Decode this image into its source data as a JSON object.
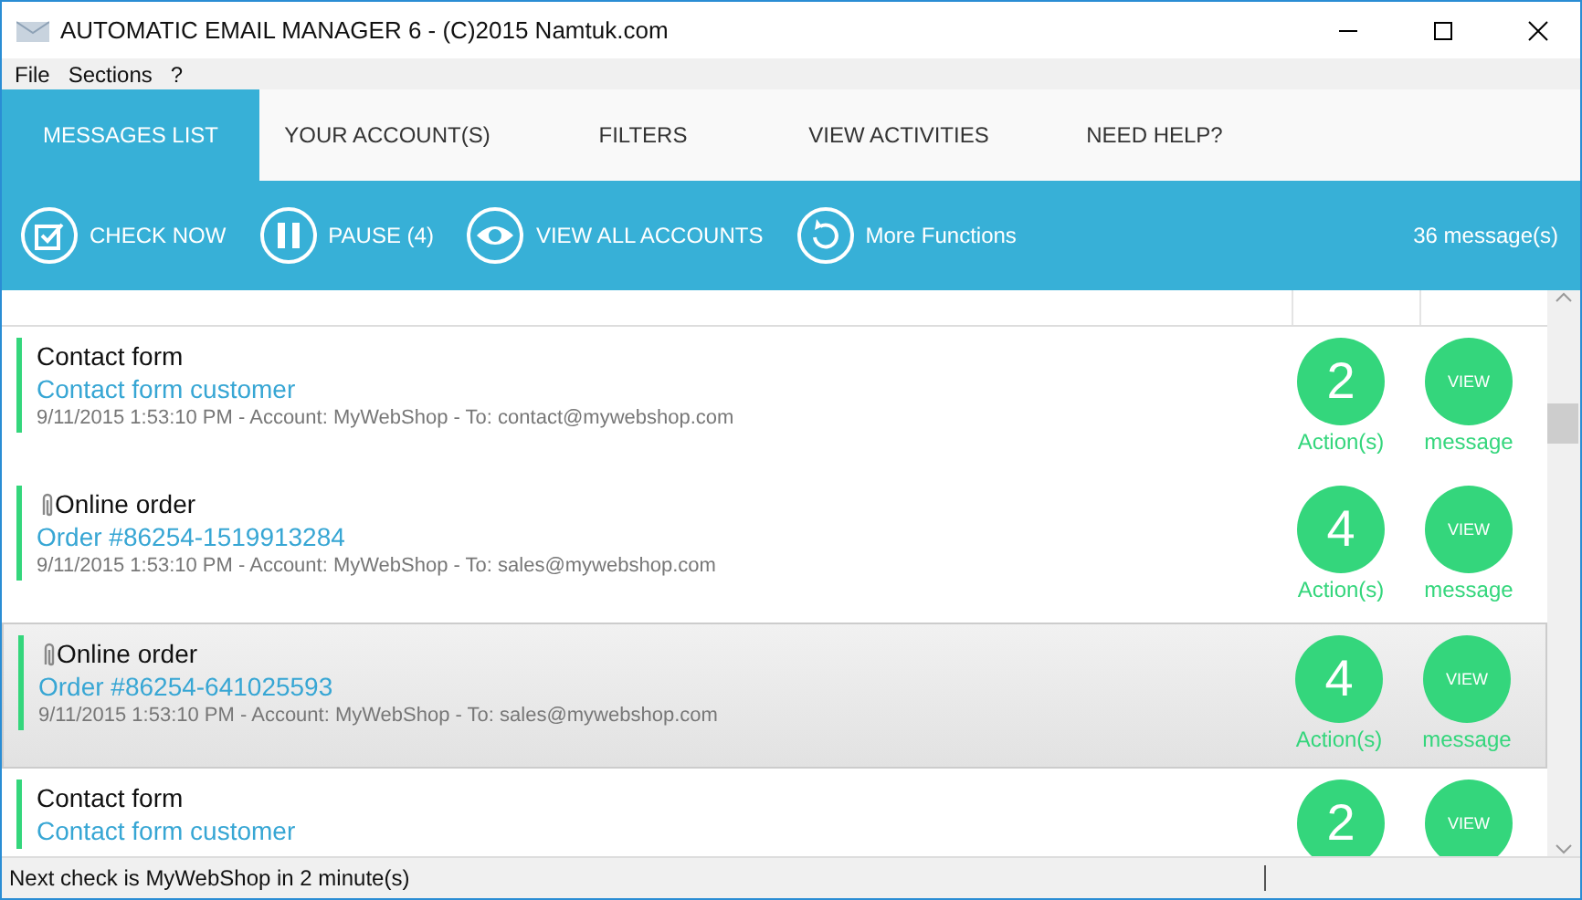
{
  "window": {
    "title": "AUTOMATIC EMAIL MANAGER 6 - (C)2015 Namtuk.com"
  },
  "menu": [
    "File",
    "Sections",
    "?"
  ],
  "tabs": [
    {
      "label": "MESSAGES LIST",
      "selected": true
    },
    {
      "label": "YOUR ACCOUNT(S)",
      "selected": false
    },
    {
      "label": "FILTERS",
      "selected": false
    },
    {
      "label": "VIEW ACTIVITIES",
      "selected": false
    },
    {
      "label": "NEED HELP?",
      "selected": false
    }
  ],
  "toolbar": {
    "buttons": [
      {
        "kind": "check",
        "label": "CHECK NOW"
      },
      {
        "kind": "pause",
        "label": "PAUSE (4)"
      },
      {
        "kind": "eye",
        "label": "VIEW ALL ACCOUNTS"
      },
      {
        "kind": "refresh",
        "label": "More Functions"
      }
    ],
    "count": "36 message(s)"
  },
  "messages": [
    {
      "title": "Contact form",
      "attachment": false,
      "subject": "Contact form customer",
      "details": "9/11/2015 1:53:10 PM - Account: MyWebShop - To: contact@mywebshop.com",
      "actions": "2",
      "actions_label": "Action(s)",
      "view": "VIEW",
      "view_label": "message",
      "selected": false
    },
    {
      "title": "Online order",
      "attachment": true,
      "subject": "Order #86254-1519913284",
      "details": "9/11/2015 1:53:10 PM - Account: MyWebShop - To: sales@mywebshop.com",
      "actions": "4",
      "actions_label": "Action(s)",
      "view": "VIEW",
      "view_label": "message",
      "selected": false
    },
    {
      "title": "Online order",
      "attachment": true,
      "subject": "Order #86254-641025593",
      "details": "9/11/2015 1:53:10 PM - Account: MyWebShop - To: sales@mywebshop.com",
      "actions": "4",
      "actions_label": "Action(s)",
      "view": "VIEW",
      "view_label": "message",
      "selected": true
    },
    {
      "title": "Contact form",
      "attachment": false,
      "subject": "Contact form customer",
      "actions": "2",
      "view": "VIEW",
      "selected": false
    }
  ],
  "status_bar": "Next check is MyWebShop in 2 minute(s)"
}
